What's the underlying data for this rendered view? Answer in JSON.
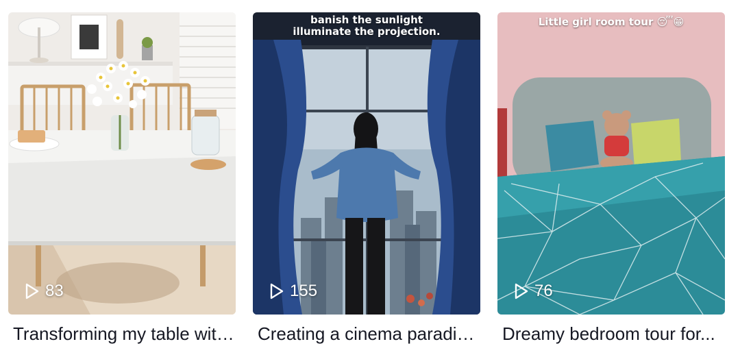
{
  "videos": [
    {
      "views": "83",
      "title": "Transforming my table with...",
      "overlay_lines": []
    },
    {
      "views": "155",
      "title": "Creating a cinema paradise...",
      "overlay_lines": [
        "banish the sunlight",
        "illuminate the projection."
      ]
    },
    {
      "views": "76",
      "title": "Dreamy bedroom tour for...",
      "overlay_lines": [
        "Little girl room tour 😴😁"
      ]
    }
  ],
  "icons": {
    "play": "play-outline-icon"
  }
}
